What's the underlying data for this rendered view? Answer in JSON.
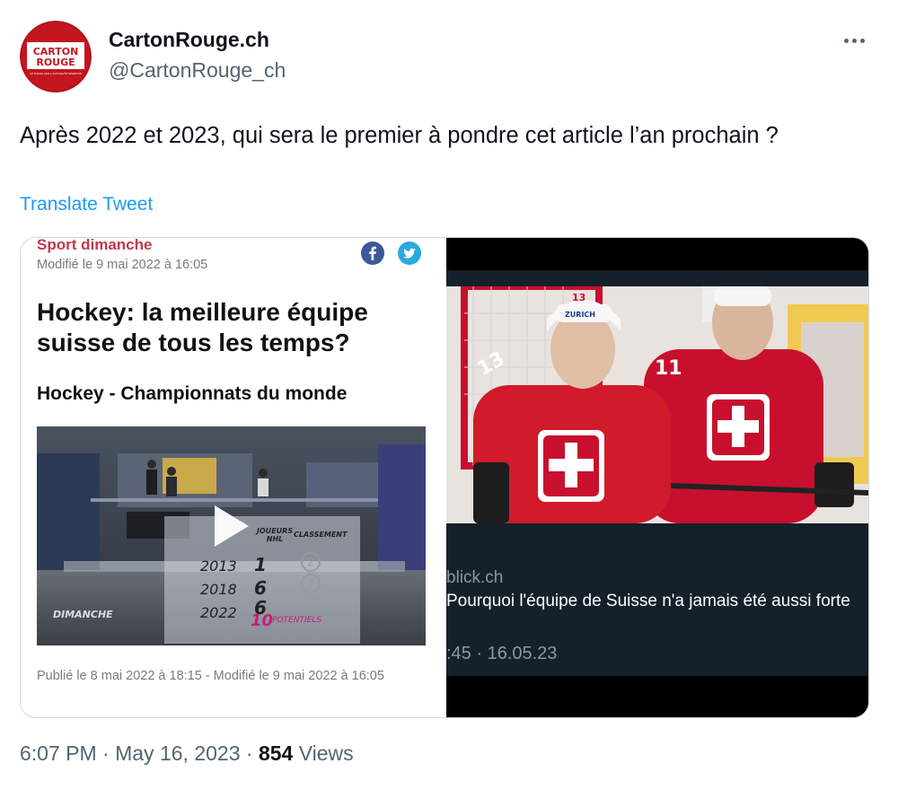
{
  "author": {
    "name": "CartonRouge.ch",
    "handle": "@CartonRouge_ch",
    "avatar_text_1": "CARTON",
    "avatar_text_2": "ROUGE",
    "avatar_tagline": "LE FOCUS SUR L'ACTUALITÉ SPORTIVE"
  },
  "tweet": {
    "text": "Après 2022 et 2023, qui sera le premier à pondre cet article l’an prochain ?",
    "translate_label": "Translate Tweet"
  },
  "left_article": {
    "section": "Sport dimanche",
    "modified": "Modifié le 9 mai 2022 à 16:05",
    "headline": "Hockey: la meilleure équipe suisse de tous les temps?",
    "subhead": "Hockey - Championnats du monde",
    "published": "Publié le 8 mai 2022 à 18:15 - Modifié le 9 mai 2022 à 16:05",
    "video": {
      "col_players": "JOUEURS NHL",
      "col_rank": "CLASSEMENT",
      "rows": [
        {
          "year": "2013",
          "nhl": "1",
          "rank": "2"
        },
        {
          "year": "2018",
          "nhl": "6",
          "rank": "2"
        },
        {
          "year": "2022",
          "nhl": "6",
          "rank": ""
        }
      ],
      "potential": "10",
      "potential_label": "POTENTIELS",
      "show_logo": "DIMANCHE"
    }
  },
  "right_article": {
    "domain": "blick.ch",
    "title": "Pourquoi l'équipe de Suisse n'a jamais été aussi forte",
    "time": ":45 · 16.05.23",
    "jersey_1": "13",
    "jersey_2": "11",
    "sponsor": "ZURICH"
  },
  "footer": {
    "time": "6:07 PM",
    "sep": " · ",
    "date": "May 16, 2023",
    "views_count": "854",
    "views_label": "Views"
  },
  "colors": {
    "accent": "#1d9bf0",
    "swiss_red": "#c8102e",
    "section_red": "#c2374a"
  }
}
